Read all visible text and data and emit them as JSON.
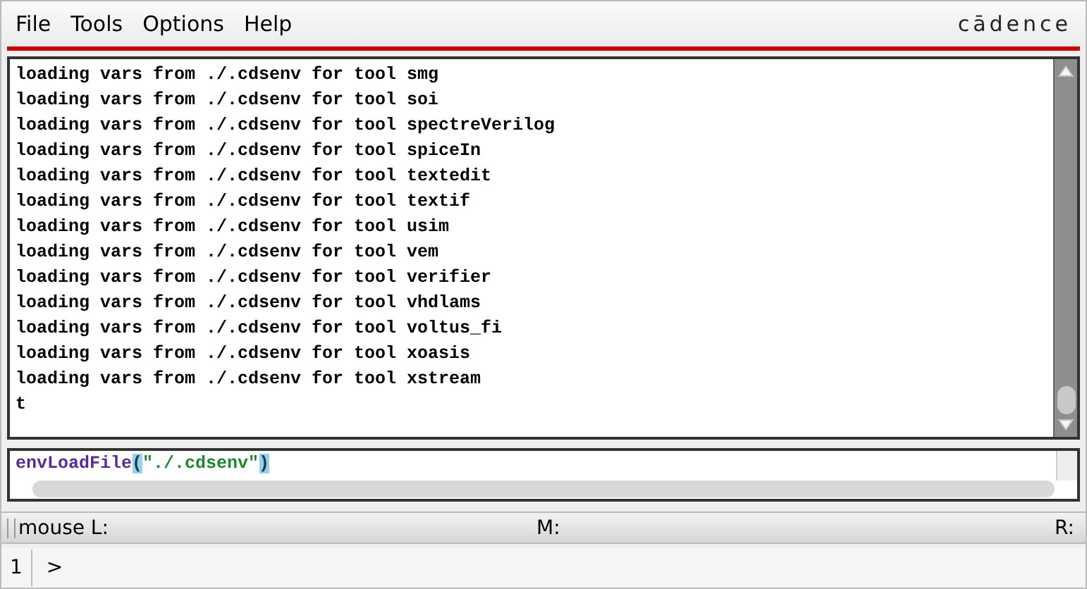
{
  "menu": [
    "File",
    "Tools",
    "Options",
    "Help"
  ],
  "logo": "cādence",
  "output_lines": [
    "loading vars from ./.cdsenv for tool smg",
    "loading vars from ./.cdsenv for tool soi",
    "loading vars from ./.cdsenv for tool spectreVerilog",
    "loading vars from ./.cdsenv for tool spiceIn",
    "loading vars from ./.cdsenv for tool textedit",
    "loading vars from ./.cdsenv for tool textif",
    "loading vars from ./.cdsenv for tool usim",
    "loading vars from ./.cdsenv for tool vem",
    "loading vars from ./.cdsenv for tool verifier",
    "loading vars from ./.cdsenv for tool vhdlams",
    "loading vars from ./.cdsenv for tool voltus_fi",
    "loading vars from ./.cdsenv for tool xoasis",
    "loading vars from ./.cdsenv for tool xstream",
    "t"
  ],
  "input_tokens": [
    {
      "kind": "function",
      "text": "envLoadFile"
    },
    {
      "kind": "paren",
      "text": "("
    },
    {
      "kind": "string",
      "text": "\"./.cdsenv\""
    },
    {
      "kind": "paren",
      "text": ")"
    }
  ],
  "status_bar": {
    "left": "mouse L:",
    "middle": "M:",
    "right": "R:"
  },
  "command_line": {
    "number": "1",
    "prompt": ">"
  }
}
